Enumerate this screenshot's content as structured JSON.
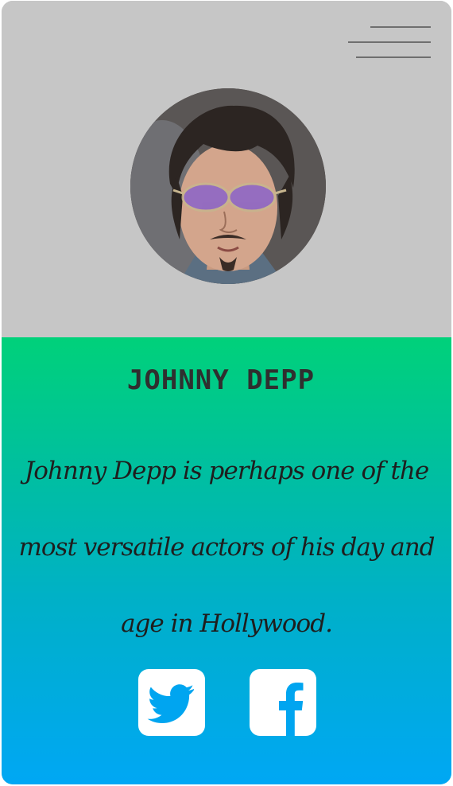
{
  "header": {
    "menu_icon": "hamburger-icon"
  },
  "profile": {
    "photo_alt": "Johnny Depp",
    "name": "JOHNNY DEPP",
    "bio": "Johnny Depp is perhaps one of the most versatile actors of his day and age in Hollywood."
  },
  "social": [
    {
      "name": "twitter",
      "icon": "twitter-icon",
      "color": "#00a5f0"
    },
    {
      "name": "facebook",
      "icon": "facebook-icon",
      "color": "#00a5f0"
    }
  ],
  "colors": {
    "top_background": "#c6c6c6",
    "gradient_top": "#00d17a",
    "gradient_bottom": "#00a7f4",
    "name_text": "#2f2f2f"
  }
}
